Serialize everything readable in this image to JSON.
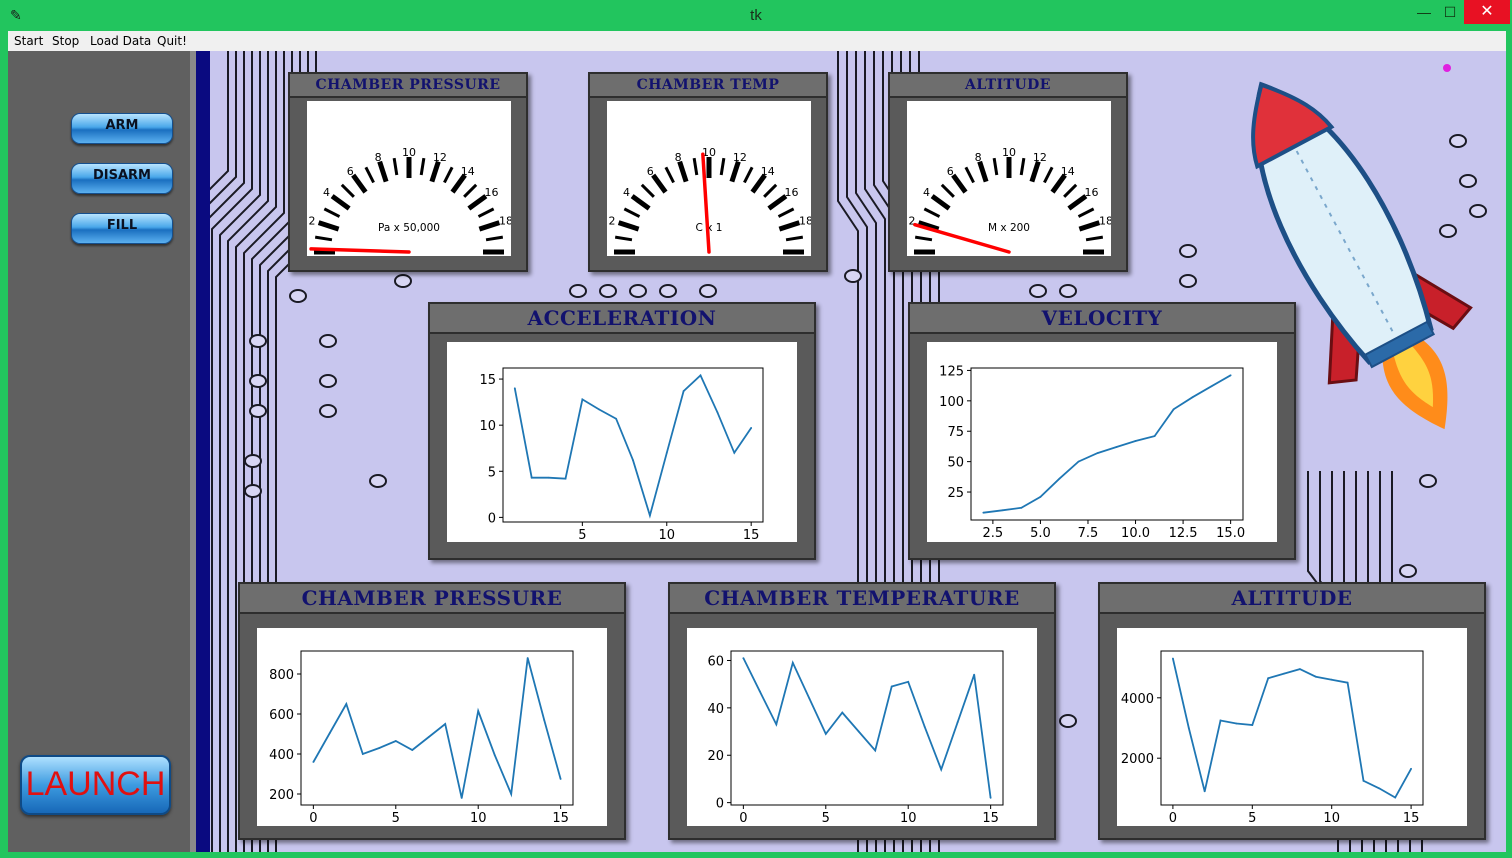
{
  "window": {
    "title": "tk"
  },
  "menu": [
    "Start",
    "Stop",
    "Load Data",
    "Quit!"
  ],
  "sidebar": {
    "buttons": [
      "ARM",
      "DISARM",
      "FILL"
    ],
    "launch": "LAUNCH"
  },
  "gauges": [
    {
      "title": "CHAMBER PRESSURE",
      "unit": "Pa x 50,000",
      "ticks": [
        "2",
        "4",
        "6",
        "8",
        "10",
        "12",
        "14",
        "16",
        "18"
      ],
      "needle_value": 0.2
    },
    {
      "title": "CHAMBER TEMP",
      "unit": "C x 1",
      "ticks": [
        "2",
        "4",
        "6",
        "8",
        "10",
        "12",
        "14",
        "16",
        "18"
      ],
      "needle_value": 9.6
    },
    {
      "title": "ALTITUDE",
      "unit": "M x 200",
      "ticks": [
        "2",
        "4",
        "6",
        "8",
        "10",
        "12",
        "14",
        "16",
        "18"
      ],
      "needle_value": 1.8
    }
  ],
  "colors": {
    "line": "#1f77b4",
    "needle": "#ff0000",
    "frame_title": "#12126e",
    "background": "#c8c6ee"
  },
  "chart_data": [
    {
      "type": "line",
      "title": "ACCELERATION",
      "x": [
        1,
        2,
        3,
        4,
        5,
        6,
        7,
        8,
        9,
        10,
        11,
        12,
        13,
        14,
        15
      ],
      "values": [
        14,
        4.3,
        4.3,
        4.2,
        12.8,
        11.7,
        10.7,
        6.2,
        0.2,
        7,
        13.7,
        15.4,
        11.4,
        7,
        9.7
      ],
      "xlim": [
        0.3,
        15.7
      ],
      "ylim": [
        -0.5,
        16.2
      ],
      "xticks": [
        5,
        10,
        15
      ],
      "yticks": [
        0,
        5,
        10,
        15
      ]
    },
    {
      "type": "line",
      "title": "VELOCITY",
      "x": [
        2,
        3,
        4,
        5,
        6,
        7,
        8,
        9,
        10,
        11,
        12,
        13,
        14,
        15
      ],
      "values": [
        8,
        10,
        12,
        21,
        36,
        50,
        57,
        62,
        67,
        71,
        93,
        103,
        112,
        121
      ],
      "xlim": [
        1.35,
        15.65
      ],
      "ylim": [
        2,
        127
      ],
      "xticks": [
        2.5,
        5.0,
        7.5,
        10.0,
        12.5,
        15.0
      ],
      "yticks": [
        25,
        50,
        75,
        100,
        125
      ],
      "xtick_labels": [
        "2.5",
        "5.0",
        "7.5",
        "10.0",
        "12.5",
        "15.0"
      ]
    },
    {
      "type": "line",
      "title": "CHAMBER PRESSURE",
      "x": [
        0,
        1,
        2,
        3,
        4,
        5,
        6,
        7,
        8,
        9,
        10,
        11,
        12,
        13,
        14,
        15
      ],
      "values": [
        360,
        505,
        650,
        400,
        430,
        465,
        420,
        485,
        550,
        180,
        615,
        395,
        200,
        880,
        570,
        275
      ],
      "xlim": [
        -0.75,
        15.75
      ],
      "ylim": [
        145,
        915
      ],
      "xticks": [
        0,
        5,
        10,
        15
      ],
      "yticks": [
        200,
        400,
        600,
        800
      ]
    },
    {
      "type": "line",
      "title": "CHAMBER TEMPERATURE",
      "x": [
        0,
        1,
        2,
        3,
        4,
        5,
        6,
        7,
        8,
        9,
        10,
        11,
        12,
        13,
        14,
        15
      ],
      "values": [
        61,
        47,
        33,
        59,
        44,
        29,
        38,
        30,
        22,
        49,
        51,
        32,
        14,
        34,
        54,
        2
      ],
      "xlim": [
        -0.75,
        15.75
      ],
      "ylim": [
        -1,
        64
      ],
      "xticks": [
        0,
        5,
        10,
        15
      ],
      "yticks": [
        0,
        20,
        40,
        60
      ]
    },
    {
      "type": "line",
      "title": "ALTITUDE",
      "x": [
        0,
        1,
        2,
        3,
        4,
        5,
        6,
        7,
        8,
        9,
        10,
        11,
        12,
        13,
        14,
        15
      ],
      "values": [
        5300,
        3000,
        900,
        3250,
        3150,
        3100,
        4650,
        4800,
        4950,
        4700,
        4600,
        4500,
        1250,
        1000,
        700,
        1650
      ],
      "xlim": [
        -0.75,
        15.75
      ],
      "ylim": [
        450,
        5550
      ],
      "xticks": [
        0,
        5,
        10,
        15
      ],
      "yticks": [
        2000,
        4000
      ]
    }
  ]
}
